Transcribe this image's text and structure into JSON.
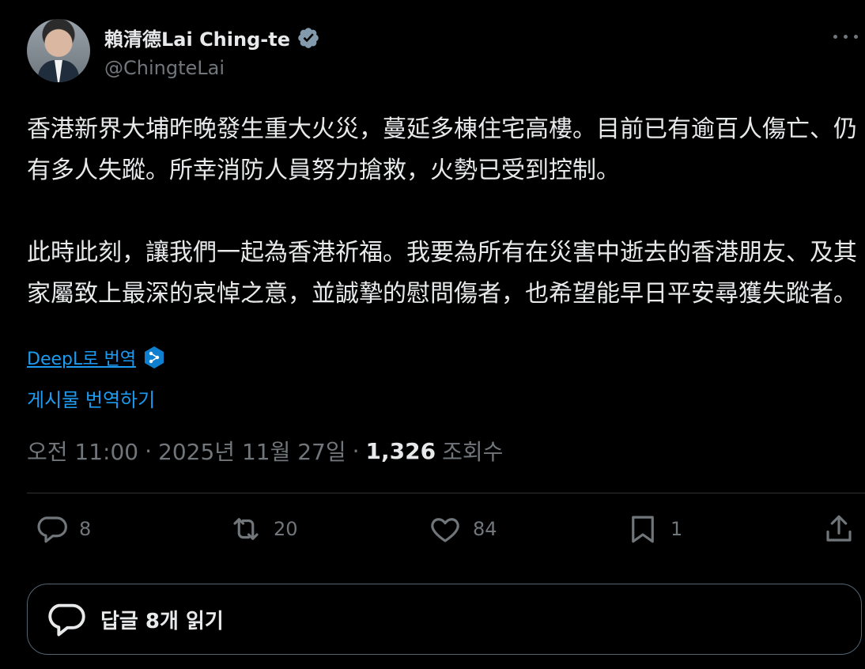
{
  "author": {
    "name": "賴清德Lai Ching-te",
    "handle": "@ChingteLai",
    "verified": true
  },
  "post": {
    "text": "香港新界大埔昨晚發生重大火災，蔓延多棟住宅高樓。目前已有逾百人傷亡、仍有多人失蹤。所幸消防人員努力搶救，火勢已受到控制。\n\n此時此刻，讓我們一起為香港祈福。我要為所有在災害中逝去的香港朋友、及其家屬致上最深的哀悼之意，並誠摯的慰問傷者，也希望能早日平安尋獲失蹤者。",
    "deepl_link": "DeepL로 번역",
    "translate_link": "게시물 번역하기",
    "time": "오전 11:00",
    "date": "2025년 11월 27일",
    "separator": "·",
    "views": "1,326",
    "views_label": "조회수"
  },
  "actions": {
    "reply_count": "8",
    "repost_count": "20",
    "like_count": "84",
    "bookmark_count": "1"
  },
  "replies_button": {
    "label": "답글 8개 읽기"
  },
  "colors": {
    "background": "#000000",
    "text": "#e7e9ea",
    "secondary": "#71767b",
    "link": "#1d9bf0",
    "verified": "#829aab"
  },
  "icons": [
    "verified-badge-icon",
    "more-icon",
    "deepl-icon",
    "reply-icon",
    "repost-icon",
    "like-icon",
    "bookmark-icon",
    "share-icon",
    "speech-bubble-icon"
  ]
}
